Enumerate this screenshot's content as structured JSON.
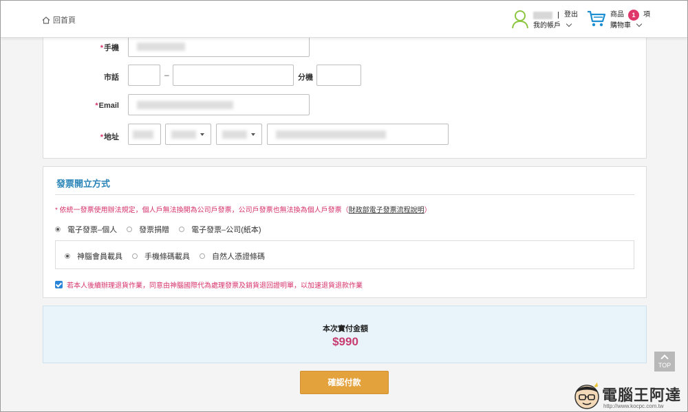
{
  "header": {
    "home_label": "回首頁",
    "logout_label": "登出",
    "account_label": "我的帳戶",
    "cart_label": "商品",
    "cart_count": "1",
    "cart_unit": "項",
    "cart_sub_label": "購物車"
  },
  "contact_form": {
    "mobile_label": "手機",
    "phone_label": "市話",
    "phone_dash": "–",
    "ext_label": "分機",
    "email_label": "Email",
    "address_label": "地址",
    "required_mark": "*"
  },
  "invoice": {
    "title": "發票開立方式",
    "notice_text": "* 依統一發票使用辦法規定，個人戶無法換開為公司戶發票，公司戶發票也無法換為個人戶發票（",
    "notice_link": "財政部電子發票流程說明",
    "notice_end": "）",
    "type_options": [
      "電子發票–個人",
      "發票捐贈",
      "電子發票–公司(紙本)"
    ],
    "type_selected": 0,
    "carrier_options": [
      "神腦會員載具",
      "手機條碼載具",
      "自然人憑證條碼"
    ],
    "carrier_selected": 0,
    "agree_text": "若本人後續辦理退貨作業，同意由神腦國際代為處理發票及銷貨退回證明單，以加速退貨退款作業",
    "agree_checked": true
  },
  "payment": {
    "label": "本次實付金額",
    "amount": "$990",
    "confirm_label": "確認付款"
  },
  "top_button_label": "TOP",
  "watermark": {
    "text": "電腦王阿達",
    "url": "http://www.kocpc.com.tw"
  }
}
